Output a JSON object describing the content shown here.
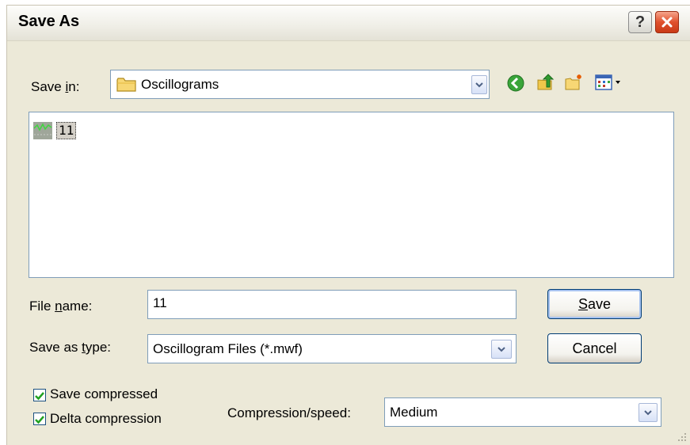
{
  "dialog": {
    "title": "Save As"
  },
  "save_in": {
    "label_pre": "Save ",
    "label_ul": "i",
    "label_post": "n:",
    "value": "Oscillograms"
  },
  "toolbar_icons": [
    "back-icon",
    "up-folder-icon",
    "new-folder-icon",
    "views-menu-icon"
  ],
  "files": [
    {
      "name": "11",
      "icon": "oscillogram-file-icon"
    }
  ],
  "file_name": {
    "label_pre": "File ",
    "label_ul": "n",
    "label_post": "ame:",
    "value": "11"
  },
  "save_type": {
    "label_pre": "Save as ",
    "label_ul": "t",
    "label_post": "ype:",
    "value": "Oscillogram Files (*.mwf)"
  },
  "buttons": {
    "save_ul": "S",
    "save_post": "ave",
    "cancel": "Cancel"
  },
  "options": {
    "save_compressed": {
      "label": "Save compressed",
      "checked": true
    },
    "delta_compression": {
      "label": "Delta compression",
      "checked": true
    }
  },
  "compression": {
    "label": "Compression/speed:",
    "value": "Medium"
  },
  "colors": {
    "dialog_bg": "#ece9d8",
    "check_green": "#21a121",
    "close_red": "#e0512d"
  }
}
